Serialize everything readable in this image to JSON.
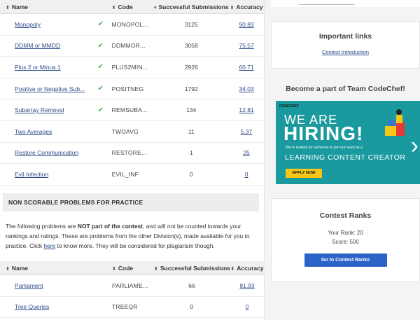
{
  "table_headers": {
    "name": "Name",
    "code": "Code",
    "submissions": "Successful Submissions",
    "accuracy": "Accuracy"
  },
  "scorable_problems": [
    {
      "name": "Monopoly",
      "solved": true,
      "code": "MONOPOL...",
      "submissions": "3125",
      "accuracy": "90.83"
    },
    {
      "name": "DDMM or MMDD",
      "solved": true,
      "code": "DDMMOR...",
      "submissions": "3058",
      "accuracy": "75.57"
    },
    {
      "name": "Plus 2 or Minus 1",
      "solved": true,
      "code": "PLUS2MIN...",
      "submissions": "2926",
      "accuracy": "60.71"
    },
    {
      "name": "Positive or Negative Sub...",
      "solved": true,
      "code": "POSITNEG",
      "submissions": "1792",
      "accuracy": "34.03"
    },
    {
      "name": "Subarray Removal",
      "solved": true,
      "code": "REMSUBA...",
      "submissions": "134",
      "accuracy": "12.81"
    },
    {
      "name": "Two Averages",
      "solved": false,
      "code": "TWOAVG",
      "submissions": "11",
      "accuracy": "5.37"
    },
    {
      "name": "Restore Communication",
      "solved": false,
      "code": "RESTORE...",
      "submissions": "1",
      "accuracy": "25"
    },
    {
      "name": "Evil Infection",
      "solved": false,
      "code": "EVIL_INF",
      "submissions": "0",
      "accuracy": "0"
    }
  ],
  "non_scorable": {
    "heading": "NON SCORABLE PROBLEMS FOR PRACTICE",
    "text_before": "The following problems are ",
    "text_bold": "NOT part of the contest",
    "text_middle": ", and will not be counted towards your rankings and ratings. These are problems from the other Division(s), made available for you to practice. Click ",
    "text_link": "here",
    "text_after": " to know more. They will be considered for plagiarism though.",
    "problems": [
      {
        "name": "Parliament",
        "code": "PARLIAME...",
        "submissions": "66",
        "accuracy": "81.93"
      },
      {
        "name": "Tree Queries",
        "code": "TREEQR",
        "submissions": "0",
        "accuracy": "0"
      }
    ]
  },
  "important_links": {
    "title": "Important links",
    "link": "Contest Introduction"
  },
  "hiring": {
    "title": "Become a part of Team CodeChef!",
    "brand": "CODECHEF",
    "line1": "WE ARE",
    "line2": "HIRING!",
    "small": "We're looking for someone to join our team as a",
    "role": "LEARNING CONTENT CREATOR",
    "apply": "APPLY NOW"
  },
  "contest_ranks": {
    "title": "Contest Ranks",
    "your_rank": "Your Rank: 20",
    "score": "Score: 500",
    "button": "Go to Contest Ranks"
  },
  "colors": {
    "link": "#2e4d8a",
    "check": "#4caf50",
    "banner": "#1a9a9e",
    "button": "#2b64c8",
    "apply": "#f5c518"
  }
}
